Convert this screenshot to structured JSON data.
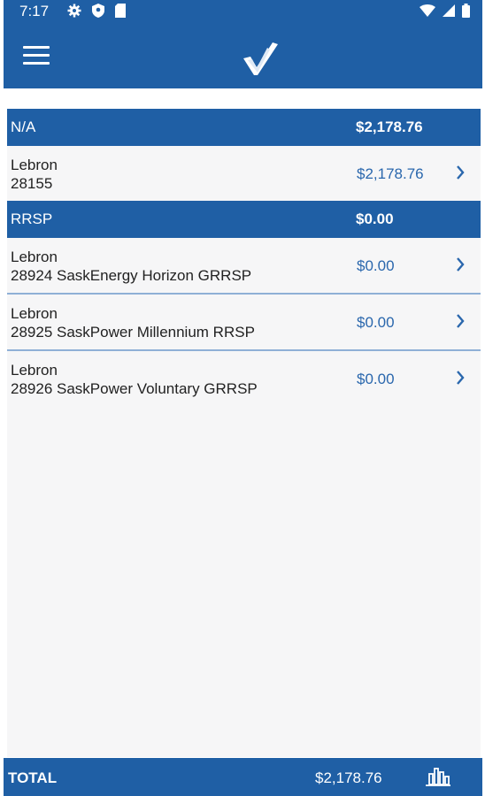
{
  "status_bar": {
    "time": "7:17"
  },
  "groups": [
    {
      "name": "N/A",
      "total": "$2,178.76",
      "rows": [
        {
          "name": "Lebron",
          "detail": "28155",
          "amount": "$2,178.76"
        }
      ]
    },
    {
      "name": "RRSP",
      "total": "$0.00",
      "rows": [
        {
          "name": "Lebron",
          "detail": "28924 SaskEnergy Horizon GRRSP",
          "amount": "$0.00"
        },
        {
          "name": "Lebron",
          "detail": "28925 SaskPower Millennium RRSP",
          "amount": "$0.00"
        },
        {
          "name": "Lebron",
          "detail": "28926 SaskPower Voluntary GRRSP",
          "amount": "$0.00"
        }
      ]
    }
  ],
  "footer": {
    "label": "TOTAL",
    "amount": "$2,178.76"
  },
  "icons": {
    "menu": "menu-icon",
    "logo": "checkmark-logo",
    "row_chevron": "chevron-right-icon",
    "chart": "bar-chart-icon"
  },
  "colors": {
    "primary": "#1f5fa5",
    "amount_text": "#2a67ad",
    "divider": "#8fb0d6"
  }
}
